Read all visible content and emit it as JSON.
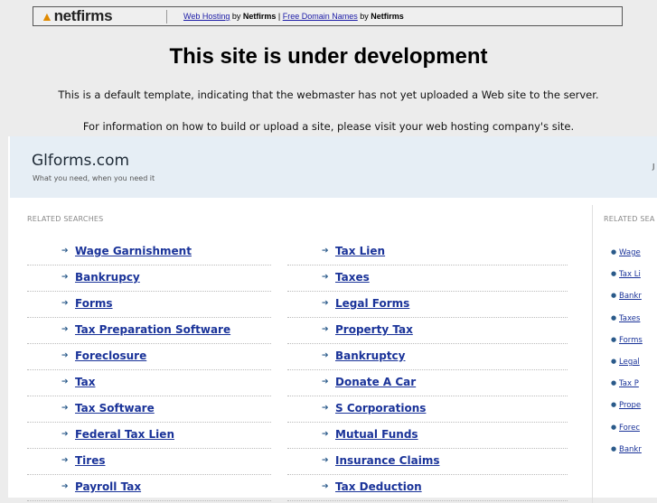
{
  "banner": {
    "logo_text": "netfirms",
    "link1": "Web Hosting",
    "by1": " by ",
    "brand1": "Netfirms",
    "pipe": " | ",
    "link2": "Free Domain Names",
    "by2": " by ",
    "brand2": "Netfirms"
  },
  "heading": "This site is under development",
  "message1": "This is a default template, indicating that the webmaster has not yet uploaded a Web site to the server.",
  "message2": "For information on how to build or upload a site, please visit your web hosting company's site.",
  "site": {
    "title": "Glforms.com",
    "tagline": "What you need, when you need it",
    "right_glyph": "J"
  },
  "related_label": "RELATED SEARCHES",
  "side_label": "RELATED SEA",
  "left_column": [
    "Wage Garnishment",
    "Bankrupcy",
    "Forms",
    "Tax Preparation Software",
    "Foreclosure",
    "Tax",
    "Tax Software",
    "Federal Tax Lien",
    "Tires",
    "Payroll Tax"
  ],
  "right_column": [
    "Tax Lien",
    "Taxes",
    "Legal Forms",
    "Property Tax",
    "Bankruptcy",
    "Donate A Car",
    "S Corporations",
    "Mutual Funds",
    "Insurance Claims",
    "Tax Deduction"
  ],
  "side_items": [
    "Wage",
    "Tax Li",
    "Bankr",
    "Taxes",
    "Forms",
    "Legal",
    "Tax P",
    "Prope",
    "Forec",
    "Bankr"
  ],
  "colors": {
    "link": "#1a3399",
    "header_bg": "#e6eef5",
    "page_bg": "#ececec"
  }
}
